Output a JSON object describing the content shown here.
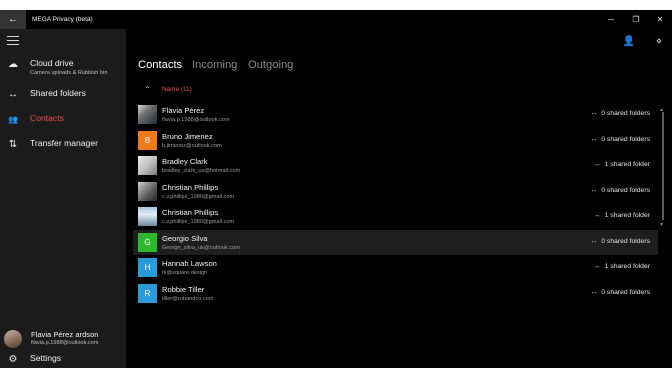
{
  "window": {
    "title": "MEGA Privacy (beta)",
    "controls": {
      "minimize": "─",
      "restore": "❐",
      "close": "✕"
    },
    "back_glyph": "←"
  },
  "sidebar": {
    "items": [
      {
        "label": "Cloud drive",
        "sublabel": "Camera uploads & Rubbish bin",
        "icon": "cloud-icon",
        "glyph": "☁"
      },
      {
        "label": "Shared folders",
        "icon": "shared-arrows-icon",
        "glyph": "↔"
      },
      {
        "label": "Contacts",
        "icon": "contacts-icon",
        "glyph": "👥"
      },
      {
        "label": "Transfer manager",
        "icon": "transfer-icon",
        "glyph": "⇅"
      }
    ],
    "account": {
      "name": "Flavia Pérez ardson",
      "email": "flavia.p.1988@outlook.com"
    },
    "settings": {
      "label": "Settings",
      "glyph": "⚙"
    },
    "accent_color": "#e84e4e"
  },
  "header": {
    "add_contact_glyph": "👤",
    "more_glyph": "⋄"
  },
  "tabs": [
    {
      "label": "Contacts",
      "active": true
    },
    {
      "label": "Incoming",
      "active": false
    },
    {
      "label": "Outgoing",
      "active": false
    }
  ],
  "sort": {
    "label": "Name (11)",
    "chevron": "⌃"
  },
  "contacts": [
    {
      "name": "Flavia Pérez",
      "email": "flavia.p.1988@outlook.com",
      "avatar": "photo",
      "initial": "",
      "color": "",
      "shared": "0 shared folders"
    },
    {
      "name": "Bruno Jimenez",
      "email": "b.jimenez@outlook.com",
      "avatar": "initial",
      "initial": "B",
      "color": "#f07a1a",
      "shared": "0 shared folders"
    },
    {
      "name": "Bradley Clark",
      "email": "bradley_clark_us@hotmail.com",
      "avatar": "photo",
      "initial": "",
      "color": "",
      "shared": "1 shared folder"
    },
    {
      "name": "Christian Phillips",
      "email": "c.v.phillips_1980@gmail.com",
      "avatar": "photo",
      "initial": "",
      "color": "",
      "shared": "0 shared folders"
    },
    {
      "name": "Christian Phillips",
      "email": "c.v.phillips_1980@gmail.com",
      "avatar": "photo",
      "initial": "",
      "color": "",
      "shared": "1 shared folder"
    },
    {
      "name": "Georgio Silva",
      "email": "George_silva_uk@outlook.com",
      "avatar": "initial",
      "initial": "G",
      "color": "#2eb82e",
      "shared": "0 shared folders",
      "selected": true
    },
    {
      "name": "Hannah Lawson",
      "email": "hl@square.design",
      "avatar": "initial",
      "initial": "H",
      "color": "#2a9bd8",
      "shared": "1 shared folder"
    },
    {
      "name": "Robbie Tiller",
      "email": "tiller@robandco.com",
      "avatar": "initial",
      "initial": "R",
      "color": "#2a9bd8",
      "shared": "0 shared folders"
    }
  ],
  "share_glyph": "↔"
}
